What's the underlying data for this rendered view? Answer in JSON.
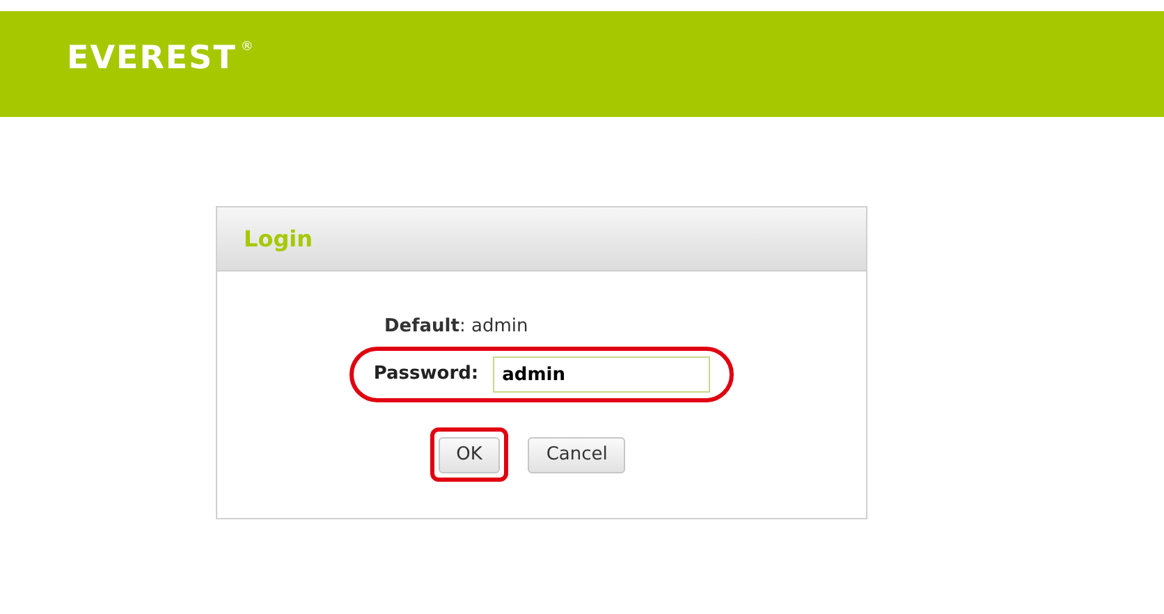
{
  "header": {
    "logo": "EVEREST",
    "logo_mark": "®"
  },
  "login": {
    "title": "Login",
    "default_note": "**Default**: admin",
    "password": {
      "label": "Password:",
      "value": "admin",
      "highlighted": true
    },
    "buttons": [
      {
        "label": "OK",
        "highlighted": true
      },
      {
        "label": "Cancel",
        "highlighted": false
      }
    ]
  }
}
